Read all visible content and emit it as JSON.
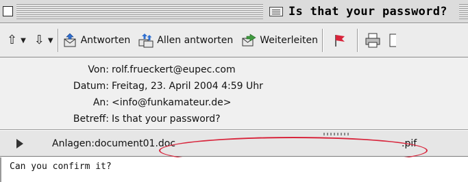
{
  "window": {
    "title": "Is that your password?"
  },
  "toolbar": {
    "items": [
      {
        "icon": "up-arrow-icon",
        "label": ""
      },
      {
        "icon": "down-arrow-icon",
        "label": ""
      },
      {
        "icon": "reply-icon",
        "label": "Antworten"
      },
      {
        "icon": "reply-all-icon",
        "label": "Allen antworten"
      },
      {
        "icon": "forward-icon",
        "label": "Weiterleiten"
      },
      {
        "icon": "flag-icon",
        "label": ""
      },
      {
        "icon": "print-icon",
        "label": ""
      }
    ]
  },
  "headers": {
    "from_label": "Von:",
    "from_value": "rolf.frueckert@eupec.com",
    "date_label": "Datum:",
    "date_value": "Freitag, 23. April 2004 4:59 Uhr",
    "to_label": "An:",
    "to_value": "<info@funkamateur.de>",
    "subject_label": "Betreff:",
    "subject_value": "Is that your password?"
  },
  "attachments": {
    "label": "Anlagen:",
    "filename": "document01.doc",
    "extension": ".pif"
  },
  "message": {
    "body": "Can you confirm it?"
  },
  "colors": {
    "highlight": "#d8243b",
    "titlebar": "#dcdcdc",
    "header_bg": "#f0f0f0"
  }
}
